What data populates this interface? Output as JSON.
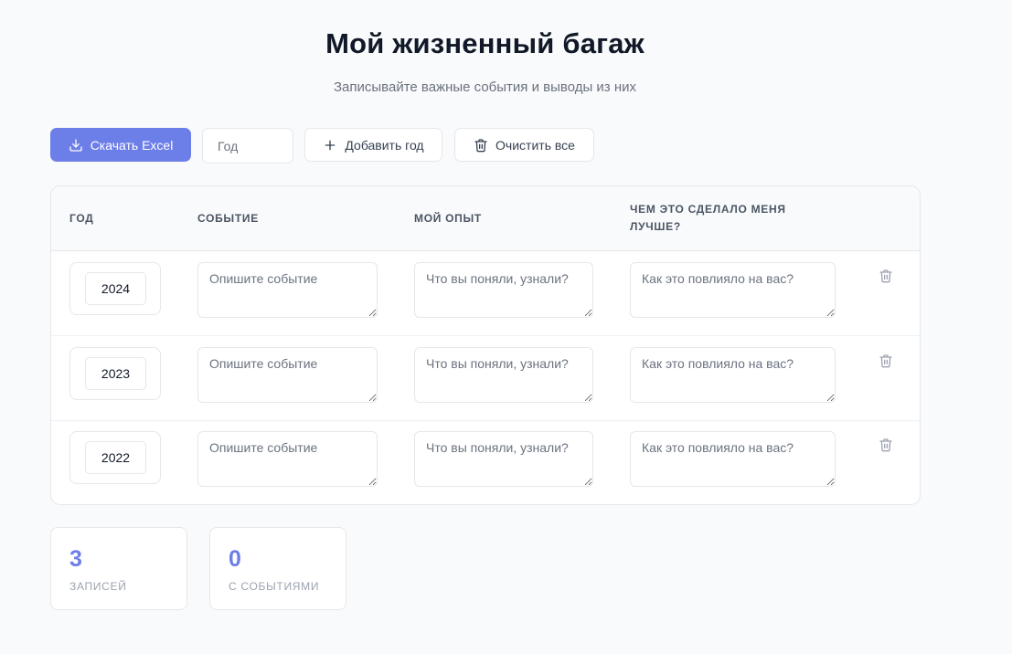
{
  "header": {
    "title": "Мой жизненный багаж",
    "subtitle": "Записывайте важные события и выводы из них"
  },
  "toolbar": {
    "download_label": "Скачать Excel",
    "download_icon": "download-icon",
    "year_placeholder": "Год",
    "year_value": "",
    "add_year_label": "Добавить год",
    "add_year_icon": "plus-icon",
    "clear_all_label": "Очистить все",
    "clear_all_icon": "trash-icon"
  },
  "table": {
    "columns": [
      "Год",
      "Событие",
      "Мой опыт",
      "Чем это сделало меня лучше?"
    ],
    "placeholders": {
      "event": "Опишите событие",
      "experience": "Что вы поняли, узнали?",
      "better": "Как это повлияло на вас?"
    },
    "rows": [
      {
        "year": "2024",
        "event": "",
        "experience": "",
        "better": ""
      },
      {
        "year": "2023",
        "event": "",
        "experience": "",
        "better": ""
      },
      {
        "year": "2022",
        "event": "",
        "experience": "",
        "better": ""
      }
    ],
    "delete_icon": "trash-icon"
  },
  "stats": [
    {
      "value": "3",
      "label": "Записей"
    },
    {
      "value": "0",
      "label": "С событиями"
    }
  ],
  "colors": {
    "accent": "#6c7ee8",
    "background": "#f9fafb",
    "text": "#111827",
    "muted": "#6b7280"
  }
}
